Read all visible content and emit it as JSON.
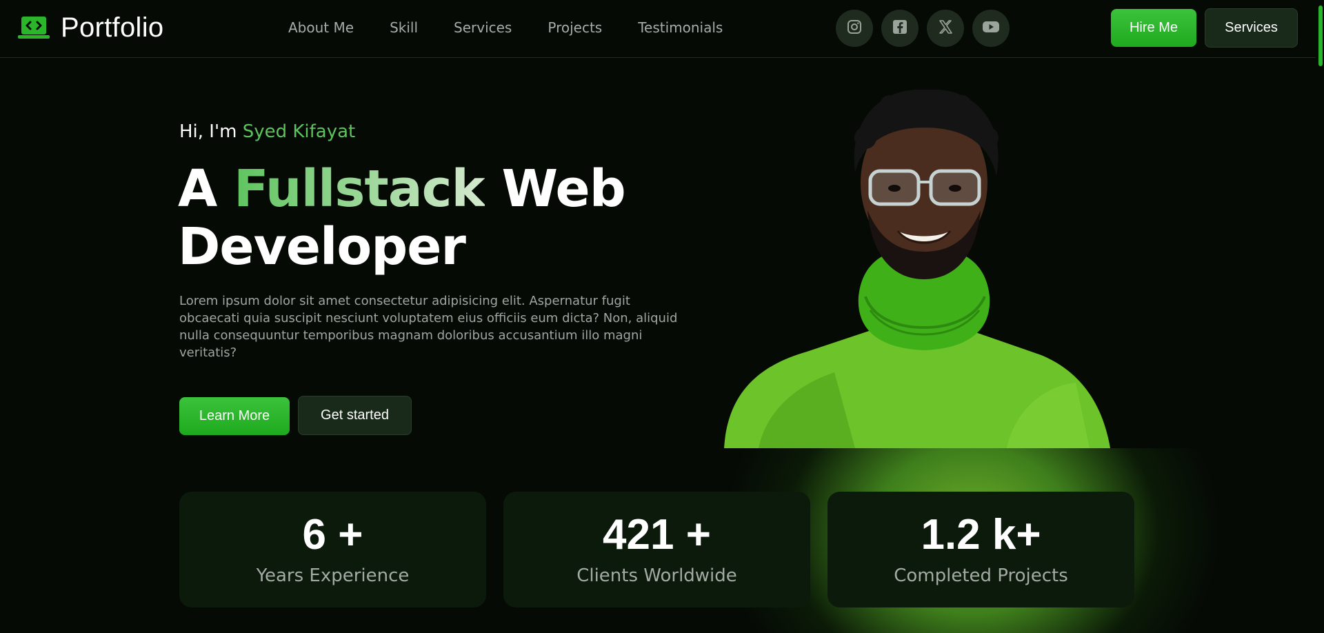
{
  "header": {
    "logo_text": "Portfolio",
    "nav": [
      "About Me",
      "Skill",
      "Services",
      "Projects",
      "Testimonials"
    ],
    "socials": [
      "instagram-icon",
      "facebook-icon",
      "x-icon",
      "youtube-icon"
    ],
    "hire_label": "Hire Me",
    "services_label": "Services"
  },
  "hero": {
    "greeting_prefix": "Hi, I'm ",
    "name": "Syed Kifayat",
    "headline_a": "A ",
    "headline_accent": "Fullstack",
    "headline_b": " Web",
    "headline_line2": "Developer",
    "description": "Lorem ipsum dolor sit amet consectetur adipisicing elit. Aspernatur fugit obcaecati quia suscipit nesciunt voluptatem eius officiis eum dicta? Non, aliquid nulla consequuntur temporibus magnam doloribus accusantium illo magni veritatis?",
    "learn_more_label": "Learn More",
    "get_started_label": "Get started"
  },
  "stats": [
    {
      "value": "6 +",
      "label": "Years Experience"
    },
    {
      "value": "421 +",
      "label": "Clients Worldwide"
    },
    {
      "value": "1.2 k+",
      "label": "Completed Projects"
    }
  ],
  "colors": {
    "background": "#050a05",
    "accent": "#5dc45d",
    "button_green": "#2bb52b",
    "card": "#0b1a0b"
  }
}
